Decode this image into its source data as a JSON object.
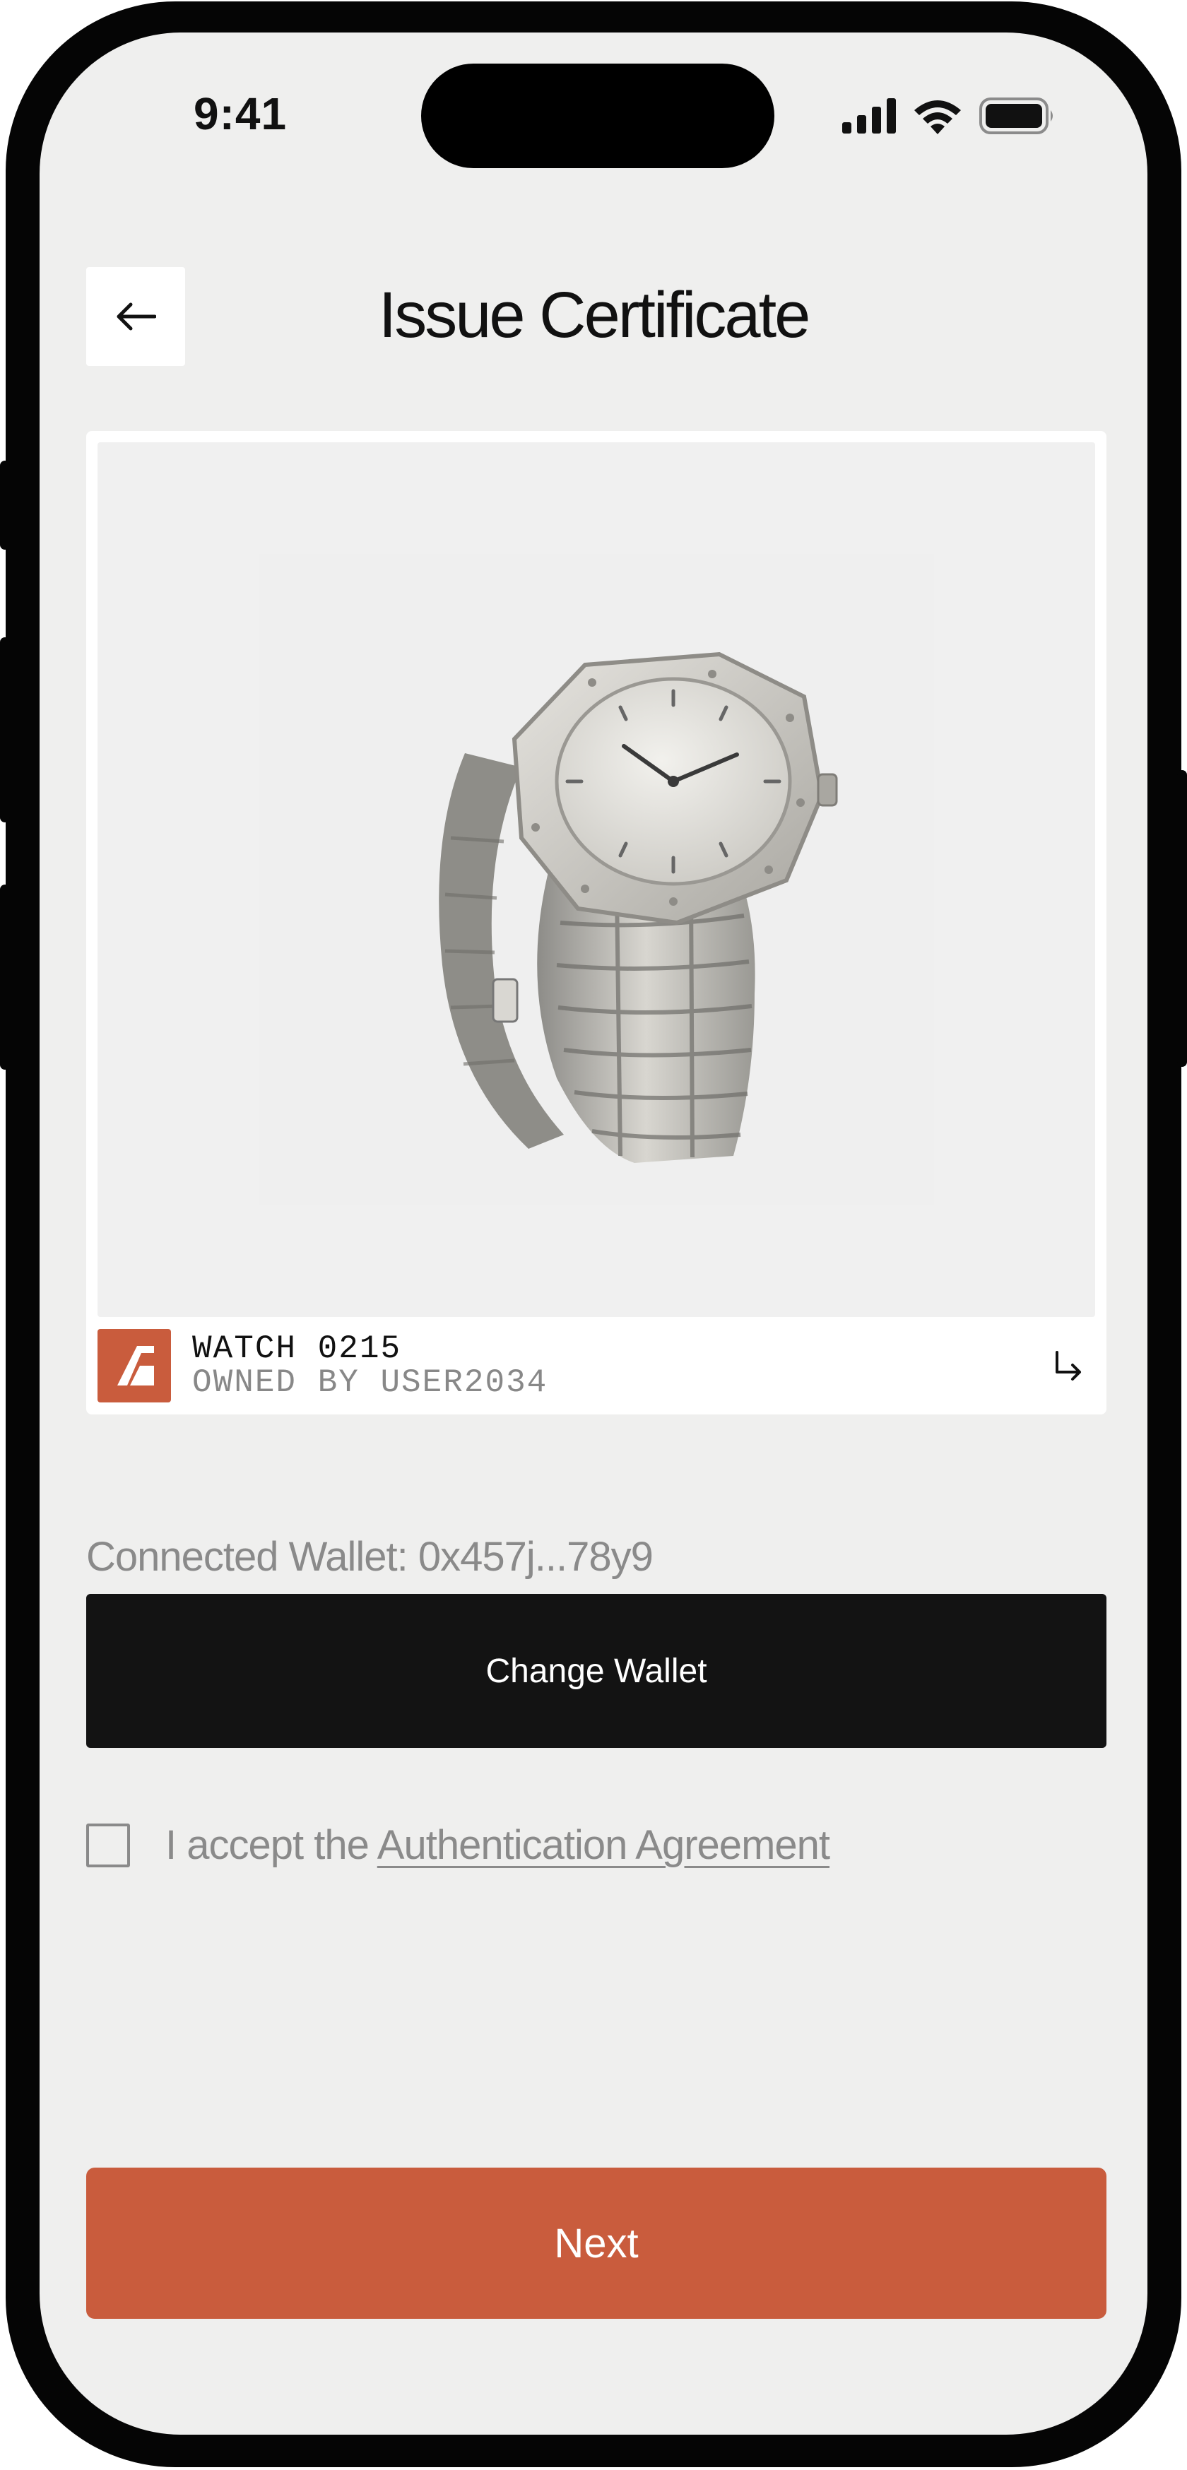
{
  "status_bar": {
    "time": "9:41",
    "icons": [
      "cellular-signal-icon",
      "wifi-icon",
      "battery-icon"
    ]
  },
  "header": {
    "back_icon": "arrow-left-icon",
    "title": "Issue Certificate"
  },
  "asset_card": {
    "image": "watch-product-image",
    "brand_logo_icon": "brand-logo-icon",
    "name": "WATCH 0215",
    "owner": "OWNED BY USER2034",
    "open_icon": "arrow-turn-down-right-icon"
  },
  "wallet": {
    "label": "Connected Wallet: 0x457j...78y9",
    "change_button": "Change Wallet"
  },
  "agreement": {
    "prefix": "I accept the ",
    "link": "Authentication Agreement",
    "checked": false
  },
  "actions": {
    "next_button": "Next"
  },
  "colors": {
    "accent": "#c95c3d",
    "dark_button": "#131313",
    "background": "#efefee",
    "muted_text": "#8a8a8a"
  }
}
